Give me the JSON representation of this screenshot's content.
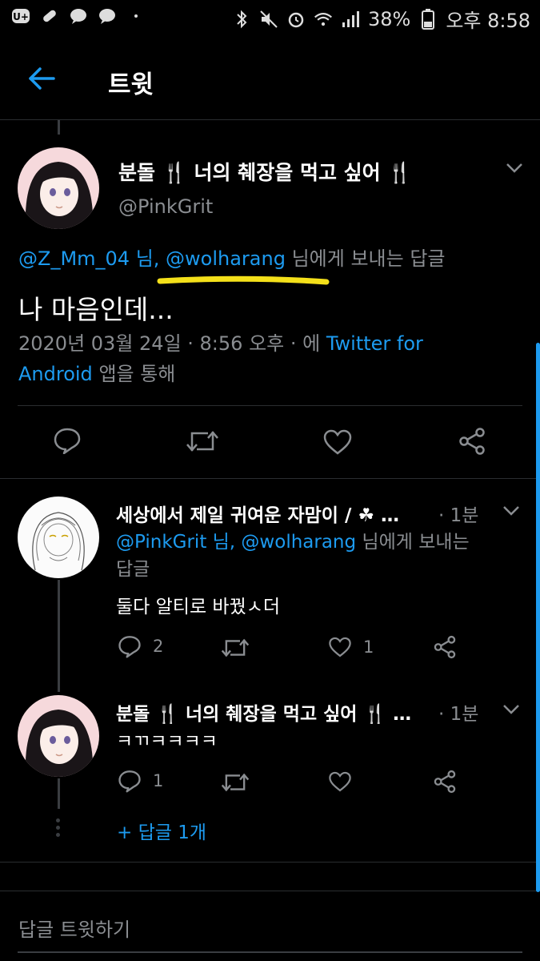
{
  "status_bar": {
    "battery": "38%",
    "time": "오후 8:58"
  },
  "header": {
    "title": "트윗"
  },
  "main_tweet": {
    "name": "분돌 🍴 너의 췌장을 먹고 싶어 🍴",
    "handle": "@PinkGrit",
    "reply_to_mentions": "@Z_Mm_04 님, @wolharang",
    "reply_to_suffix": "님에게 보내는 답글",
    "text": "나 마음인데...",
    "date_time": "2020년 03월 24일 · 8:56 오후 · 에",
    "source_part1": "Twitter for",
    "source_part2": "Android",
    "source_suffix": "앱을 통해",
    "highlight_color": "#f4e01a"
  },
  "reply1": {
    "name": "세상에서 제일 귀여운 자맘이 / ☘ …",
    "time": "· 1분",
    "reply_to_mentions": "@PinkGrit 님, @wolharang",
    "reply_to_suffix1": "님에게 보내는",
    "reply_to_suffix2": "답글",
    "text": "둘다 알티로 바꿨ㅅ더",
    "reply_count": "2",
    "like_count": "1"
  },
  "reply2": {
    "name": "분돌 🍴 너의 췌장을 먹고 싶어 🍴 …",
    "time": "· 1분",
    "text": "ㅋㄲㅋㅋㅋㅋ",
    "reply_count": "1",
    "more_replies": "+ 답글 1개"
  },
  "compose": {
    "placeholder": "답글 트윗하기"
  },
  "colors": {
    "accent": "#1d9bf0",
    "muted": "#8a8d91",
    "background": "#000000"
  }
}
